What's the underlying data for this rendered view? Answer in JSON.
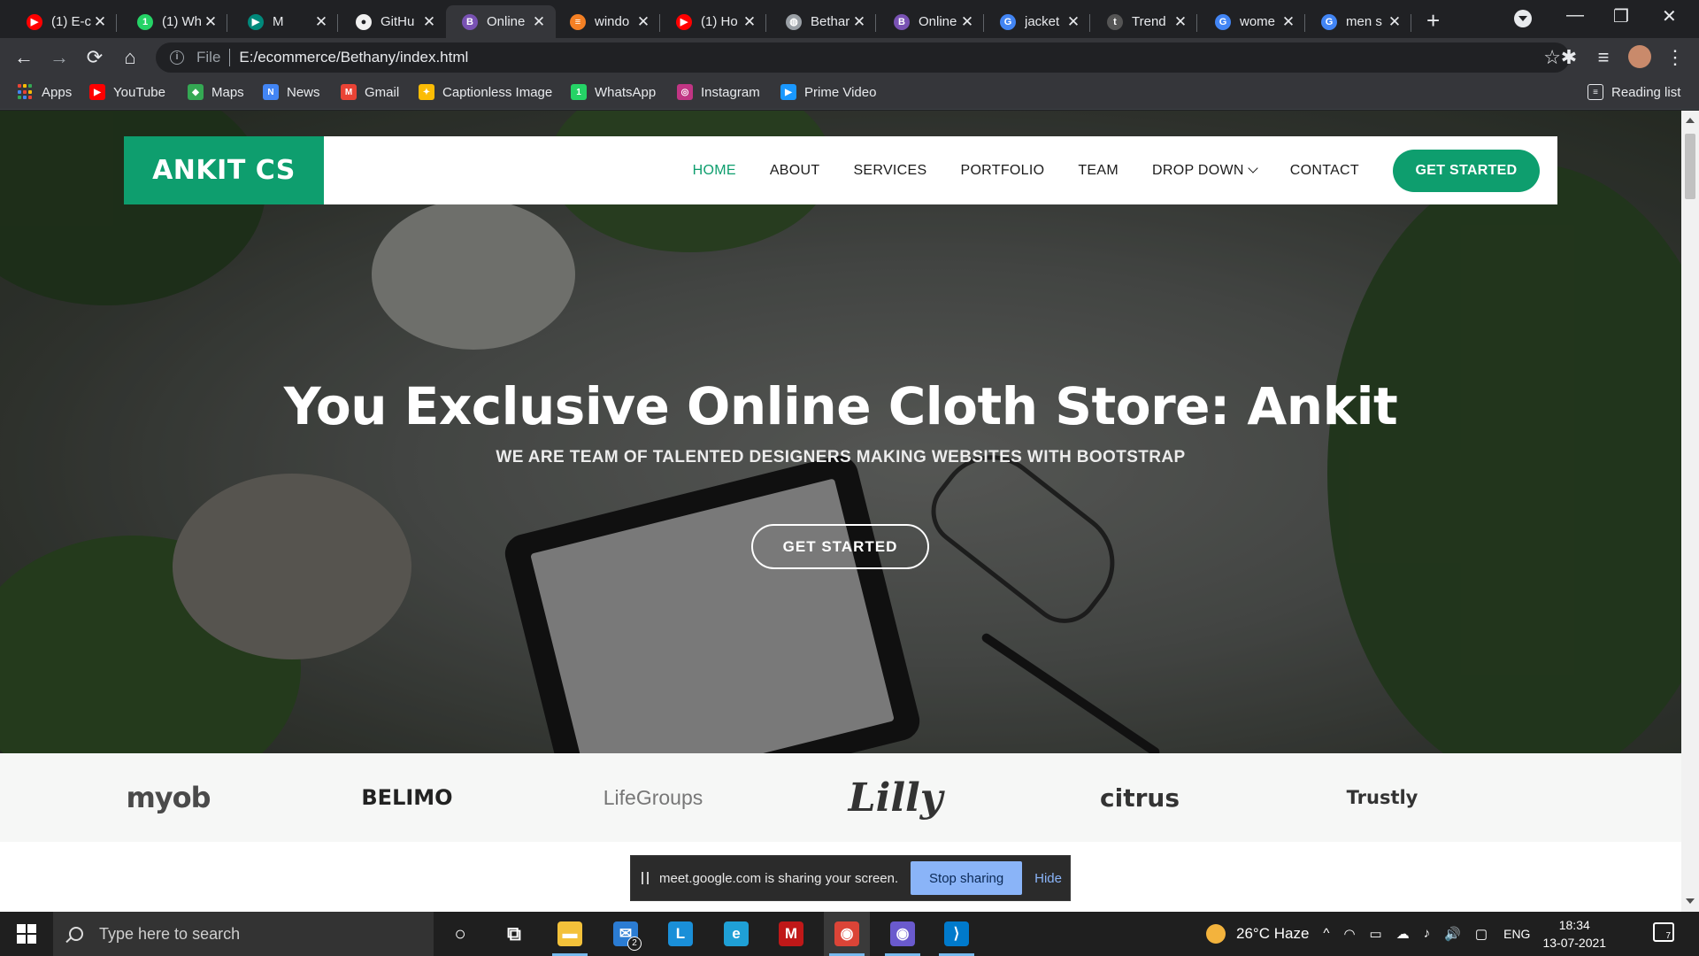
{
  "browser": {
    "tabs": [
      {
        "title": "(1) E-c",
        "icon": "youtube-icon",
        "color": "#ff0000",
        "glyph": "▶"
      },
      {
        "title": "(1) Wh",
        "icon": "whatsapp-icon",
        "color": "#25d366",
        "glyph": "1"
      },
      {
        "title": "M",
        "icon": "meet-icon",
        "color": "#00897b",
        "glyph": "▶"
      },
      {
        "title": "GitHu",
        "icon": "github-icon",
        "color": "#f0f0f0",
        "glyph": "●"
      },
      {
        "title": "Online",
        "icon": "bootstrap-icon",
        "color": "#7952b3",
        "glyph": "B"
      },
      {
        "title": "windo",
        "icon": "stackoverflow-icon",
        "color": "#f48024",
        "glyph": "≡"
      },
      {
        "title": "(1) Ho",
        "icon": "youtube-icon",
        "color": "#ff0000",
        "glyph": "▶"
      },
      {
        "title": "Bethar",
        "icon": "globe-icon",
        "color": "#9aa0a6",
        "glyph": "◍"
      },
      {
        "title": "Online",
        "icon": "bootstrap-icon",
        "color": "#7952b3",
        "glyph": "B"
      },
      {
        "title": "jacket",
        "icon": "google-icon",
        "color": "#4285f4",
        "glyph": "G"
      },
      {
        "title": "Trend",
        "icon": "trendyol-icon",
        "color": "#555555",
        "glyph": "t"
      },
      {
        "title": "wome",
        "icon": "google-icon",
        "color": "#4285f4",
        "glyph": "G"
      },
      {
        "title": "men s",
        "icon": "google-icon",
        "color": "#4285f4",
        "glyph": "G"
      }
    ],
    "active_tab_index": 4,
    "close_glyph": "✕",
    "new_tab_glyph": "+",
    "window_controls": {
      "minimize": "—",
      "restore": "❐",
      "close": "✕"
    },
    "toolbar": {
      "back": "←",
      "forward": "→",
      "reload": "⟳",
      "home": "⌂",
      "star": "☆",
      "extensions": "✱",
      "media": "≡",
      "menu": "⋮"
    },
    "address": {
      "scheme": "File",
      "url": "E:/ecommerce/Bethany/index.html",
      "info": "i"
    },
    "bookmarks": [
      {
        "label": "Apps",
        "icon": "apps-icon"
      },
      {
        "label": "YouTube",
        "icon": "youtube-icon",
        "color": "#ff0000",
        "glyph": "▶"
      },
      {
        "label": "Maps",
        "icon": "maps-icon",
        "color": "#34a853",
        "glyph": "◆"
      },
      {
        "label": "News",
        "icon": "news-icon",
        "color": "#4285f4",
        "glyph": "N"
      },
      {
        "label": "Gmail",
        "icon": "gmail-icon",
        "color": "#ea4335",
        "glyph": "M"
      },
      {
        "label": "Captionless Image",
        "icon": "captionless-icon",
        "color": "#fbbc05",
        "glyph": "✦"
      },
      {
        "label": "WhatsApp",
        "icon": "whatsapp-icon",
        "color": "#25d366",
        "glyph": "1"
      },
      {
        "label": "Instagram",
        "icon": "instagram-icon",
        "color": "#c13584",
        "glyph": "◎"
      },
      {
        "label": "Prime Video",
        "icon": "prime-video-icon",
        "color": "#1a98ff",
        "glyph": "▶"
      }
    ],
    "reading_list": "Reading list"
  },
  "site": {
    "logo": "ANKIT CS",
    "nav": [
      {
        "label": "HOME",
        "active": true
      },
      {
        "label": "ABOUT"
      },
      {
        "label": "SERVICES"
      },
      {
        "label": "PORTFOLIO"
      },
      {
        "label": "TEAM"
      },
      {
        "label": "DROP DOWN",
        "dropdown": true
      },
      {
        "label": "CONTACT"
      }
    ],
    "header_cta": "GET STARTED",
    "hero_title": "You Exclusive Online Cloth Store: Ankit",
    "hero_subtitle": "WE ARE TEAM OF TALENTED DESIGNERS MAKING WEBSITES WITH BOOTSTRAP",
    "hero_cta": "GET STARTED",
    "clients": [
      "myob",
      "BELIMO",
      "LifeGroups",
      "Lilly",
      "citrus",
      "Trustly"
    ],
    "accent_color": "#0e9e6e"
  },
  "share_bar": {
    "message": "meet.google.com is sharing your screen.",
    "stop_label": "Stop sharing",
    "hide_label": "Hide"
  },
  "taskbar": {
    "search_placeholder": "Type here to search",
    "apps": [
      {
        "name": "cortana-icon",
        "glyph": "○",
        "color": "transparent"
      },
      {
        "name": "task-view-icon",
        "glyph": "⧉",
        "color": "transparent"
      },
      {
        "name": "file-explorer-icon",
        "glyph": "▬",
        "color": "#f3c13a",
        "running": true
      },
      {
        "name": "mail-icon",
        "glyph": "✉",
        "color": "#2b7cd3",
        "badge": "2"
      },
      {
        "name": "lens-app-icon",
        "glyph": "L",
        "color": "#1a8fd8"
      },
      {
        "name": "edge-icon",
        "glyph": "e",
        "color": "#1fa0d6"
      },
      {
        "name": "mcafee-icon",
        "glyph": "M",
        "color": "#c01818"
      },
      {
        "name": "chrome-icon",
        "glyph": "◉",
        "color": "#db4437",
        "running": true,
        "active": true
      },
      {
        "name": "chrome-canary-icon",
        "glyph": "◉",
        "color": "#6a5acd",
        "running": true
      },
      {
        "name": "vscode-icon",
        "glyph": "⟩",
        "color": "#007acc",
        "running": true
      }
    ],
    "weather": "26°C  Haze",
    "tray_glyphs": [
      "^",
      "◠",
      "▭",
      "☁",
      "♪",
      "🔊",
      "▢"
    ],
    "language": "ENG",
    "time": "18:34",
    "date": "13-07-2021",
    "notification_count": "7"
  }
}
